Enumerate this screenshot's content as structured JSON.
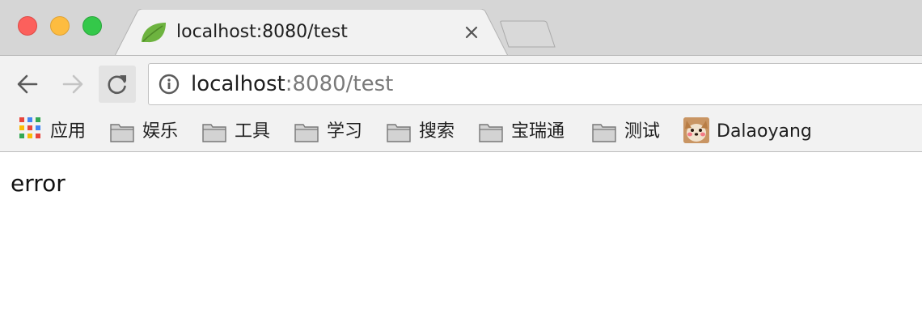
{
  "window": {
    "controls": [
      "close",
      "minimize",
      "maximize"
    ]
  },
  "tab": {
    "title": "localhost:8080/test",
    "favicon": "spring-leaf-icon",
    "close_icon": "close-icon"
  },
  "toolbar": {
    "back_icon": "arrow-left-icon",
    "forward_icon": "arrow-right-icon",
    "reload_icon": "reload-icon",
    "info_icon": "info-icon"
  },
  "address": {
    "host": "localhost",
    "rest": ":8080/test"
  },
  "bookmarks": {
    "apps_label": "应用",
    "items": [
      {
        "label": "娱乐",
        "icon": "folder-icon"
      },
      {
        "label": "工具",
        "icon": "folder-icon"
      },
      {
        "label": "学习",
        "icon": "folder-icon"
      },
      {
        "label": "搜索",
        "icon": "folder-icon"
      },
      {
        "label": "宝瑞通",
        "icon": "folder-icon"
      },
      {
        "label": "测试",
        "icon": "folder-icon"
      }
    ],
    "profile_label": "Dalaoyang"
  },
  "page": {
    "body_text": "error"
  },
  "colors": {
    "tabstrip": "#d6d6d6",
    "toolbar": "#f2f2f2",
    "close": "#fc605c",
    "minimize": "#fdbc40",
    "maximize": "#34c84a",
    "favicon": "#6db33f"
  }
}
